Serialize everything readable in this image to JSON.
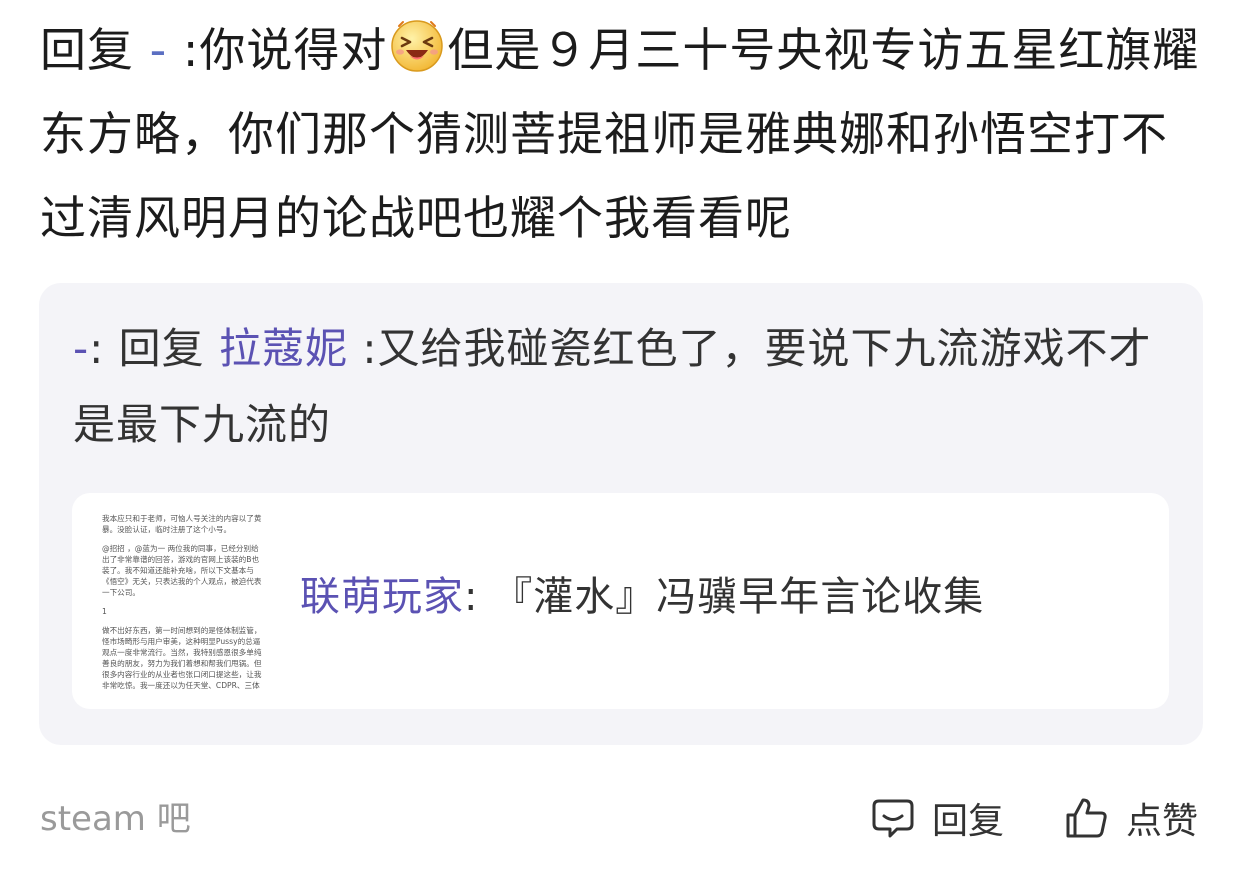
{
  "reply": {
    "prefix": "回复",
    "user": " - ",
    "separator": ":",
    "text_before_emoji": "你说得对",
    "emoji_icon": "laughing-face-icon",
    "text_after_emoji": "但是９月三十号央视专访五星红旗耀东方略，你们那个猜测菩提祖师是雅典娜和孙悟空打不过清风明月的论战吧也耀个我看看呢"
  },
  "quote": {
    "user": "-",
    "separator": ": ",
    "reply_label": "回复 ",
    "reply_to": "拉蔻妮",
    "text": " :又给我碰瓷红色了，要说下九流游戏不才是最下九流的",
    "link_card": {
      "source": "联萌玩家",
      "separator": ": ",
      "title": "『灌水』冯骥早年言论收集",
      "thumbnail_paragraphs": [
        "我本应只和于老师，可恼人号关注的内容以了黄暴。没脸认证，临时注册了这个小号。",
        "@招招 ，@蓝为一 两位我的同事，已经分别给出了非常靠谱的回答，游戏的官网上该装的B也装了。我不知道还能补充啥，所以下文基本与《悟空》无关，只表达我的个人观点，被迫代表一下公司。",
        "1",
        "做不出好东西，第一时间想到的是怪体制监管，怪市场畸形与用户审美，这种明显Pussy的总逼观点一度非常流行。当然，我特别感恩很多单纯善良的朋友，努力为我们着想和帮我们甩锅。但很多内容行业的从业者也张口闭口提这些，让我非常吃惊。我一度还以为任天堂、CDPR、三体与药神都是靠体制支持做出来的。"
      ]
    }
  },
  "footer": {
    "forum": "steam 吧",
    "reply_label": "回复",
    "reply_icon": "comment-bubble-icon",
    "like_label": "点赞",
    "like_icon": "thumbs-up-icon"
  },
  "colors": {
    "link": "#5b6fc2",
    "username": "#5b52b3",
    "quote_bg": "#f4f4f8",
    "muted": "#9a9a9a"
  }
}
